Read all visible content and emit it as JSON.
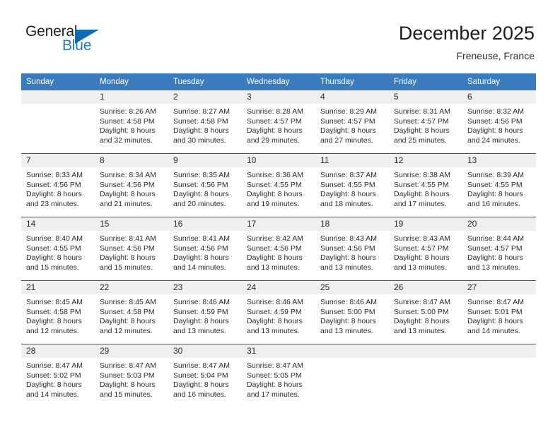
{
  "logo": {
    "word_top": "General",
    "word_bottom": "Blue",
    "triangle_color": "#0f6cb4",
    "blue_text_color": "#1f7cc2"
  },
  "header": {
    "title": "December 2025",
    "subtitle": "Freneuse, France"
  },
  "theme": {
    "header_row_bg": "#3a7cbe",
    "daynum_band_bg": "#efefef",
    "grid_line": "#1d5fa0"
  },
  "weekday_headers": [
    "Sunday",
    "Monday",
    "Tuesday",
    "Wednesday",
    "Thursday",
    "Friday",
    "Saturday"
  ],
  "labels": {
    "sunrise_prefix": "Sunrise:",
    "sunset_prefix": "Sunset:",
    "daylight_prefix": "Daylight:"
  },
  "weeks": [
    [
      {
        "day": "",
        "sunrise": "",
        "sunset": "",
        "daylight_1": "",
        "daylight_2": ""
      },
      {
        "day": "1",
        "sunrise": "Sunrise: 8:26 AM",
        "sunset": "Sunset: 4:58 PM",
        "daylight_1": "Daylight: 8 hours",
        "daylight_2": "and 32 minutes."
      },
      {
        "day": "2",
        "sunrise": "Sunrise: 8:27 AM",
        "sunset": "Sunset: 4:58 PM",
        "daylight_1": "Daylight: 8 hours",
        "daylight_2": "and 30 minutes."
      },
      {
        "day": "3",
        "sunrise": "Sunrise: 8:28 AM",
        "sunset": "Sunset: 4:57 PM",
        "daylight_1": "Daylight: 8 hours",
        "daylight_2": "and 29 minutes."
      },
      {
        "day": "4",
        "sunrise": "Sunrise: 8:29 AM",
        "sunset": "Sunset: 4:57 PM",
        "daylight_1": "Daylight: 8 hours",
        "daylight_2": "and 27 minutes."
      },
      {
        "day": "5",
        "sunrise": "Sunrise: 8:31 AM",
        "sunset": "Sunset: 4:57 PM",
        "daylight_1": "Daylight: 8 hours",
        "daylight_2": "and 25 minutes."
      },
      {
        "day": "6",
        "sunrise": "Sunrise: 8:32 AM",
        "sunset": "Sunset: 4:56 PM",
        "daylight_1": "Daylight: 8 hours",
        "daylight_2": "and 24 minutes."
      }
    ],
    [
      {
        "day": "7",
        "sunrise": "Sunrise: 8:33 AM",
        "sunset": "Sunset: 4:56 PM",
        "daylight_1": "Daylight: 8 hours",
        "daylight_2": "and 23 minutes."
      },
      {
        "day": "8",
        "sunrise": "Sunrise: 8:34 AM",
        "sunset": "Sunset: 4:56 PM",
        "daylight_1": "Daylight: 8 hours",
        "daylight_2": "and 21 minutes."
      },
      {
        "day": "9",
        "sunrise": "Sunrise: 8:35 AM",
        "sunset": "Sunset: 4:56 PM",
        "daylight_1": "Daylight: 8 hours",
        "daylight_2": "and 20 minutes."
      },
      {
        "day": "10",
        "sunrise": "Sunrise: 8:36 AM",
        "sunset": "Sunset: 4:55 PM",
        "daylight_1": "Daylight: 8 hours",
        "daylight_2": "and 19 minutes."
      },
      {
        "day": "11",
        "sunrise": "Sunrise: 8:37 AM",
        "sunset": "Sunset: 4:55 PM",
        "daylight_1": "Daylight: 8 hours",
        "daylight_2": "and 18 minutes."
      },
      {
        "day": "12",
        "sunrise": "Sunrise: 8:38 AM",
        "sunset": "Sunset: 4:55 PM",
        "daylight_1": "Daylight: 8 hours",
        "daylight_2": "and 17 minutes."
      },
      {
        "day": "13",
        "sunrise": "Sunrise: 8:39 AM",
        "sunset": "Sunset: 4:55 PM",
        "daylight_1": "Daylight: 8 hours",
        "daylight_2": "and 16 minutes."
      }
    ],
    [
      {
        "day": "14",
        "sunrise": "Sunrise: 8:40 AM",
        "sunset": "Sunset: 4:55 PM",
        "daylight_1": "Daylight: 8 hours",
        "daylight_2": "and 15 minutes."
      },
      {
        "day": "15",
        "sunrise": "Sunrise: 8:41 AM",
        "sunset": "Sunset: 4:56 PM",
        "daylight_1": "Daylight: 8 hours",
        "daylight_2": "and 15 minutes."
      },
      {
        "day": "16",
        "sunrise": "Sunrise: 8:41 AM",
        "sunset": "Sunset: 4:56 PM",
        "daylight_1": "Daylight: 8 hours",
        "daylight_2": "and 14 minutes."
      },
      {
        "day": "17",
        "sunrise": "Sunrise: 8:42 AM",
        "sunset": "Sunset: 4:56 PM",
        "daylight_1": "Daylight: 8 hours",
        "daylight_2": "and 13 minutes."
      },
      {
        "day": "18",
        "sunrise": "Sunrise: 8:43 AM",
        "sunset": "Sunset: 4:56 PM",
        "daylight_1": "Daylight: 8 hours",
        "daylight_2": "and 13 minutes."
      },
      {
        "day": "19",
        "sunrise": "Sunrise: 8:43 AM",
        "sunset": "Sunset: 4:57 PM",
        "daylight_1": "Daylight: 8 hours",
        "daylight_2": "and 13 minutes."
      },
      {
        "day": "20",
        "sunrise": "Sunrise: 8:44 AM",
        "sunset": "Sunset: 4:57 PM",
        "daylight_1": "Daylight: 8 hours",
        "daylight_2": "and 13 minutes."
      }
    ],
    [
      {
        "day": "21",
        "sunrise": "Sunrise: 8:45 AM",
        "sunset": "Sunset: 4:58 PM",
        "daylight_1": "Daylight: 8 hours",
        "daylight_2": "and 12 minutes."
      },
      {
        "day": "22",
        "sunrise": "Sunrise: 8:45 AM",
        "sunset": "Sunset: 4:58 PM",
        "daylight_1": "Daylight: 8 hours",
        "daylight_2": "and 12 minutes."
      },
      {
        "day": "23",
        "sunrise": "Sunrise: 8:46 AM",
        "sunset": "Sunset: 4:59 PM",
        "daylight_1": "Daylight: 8 hours",
        "daylight_2": "and 13 minutes."
      },
      {
        "day": "24",
        "sunrise": "Sunrise: 8:46 AM",
        "sunset": "Sunset: 4:59 PM",
        "daylight_1": "Daylight: 8 hours",
        "daylight_2": "and 13 minutes."
      },
      {
        "day": "25",
        "sunrise": "Sunrise: 8:46 AM",
        "sunset": "Sunset: 5:00 PM",
        "daylight_1": "Daylight: 8 hours",
        "daylight_2": "and 13 minutes."
      },
      {
        "day": "26",
        "sunrise": "Sunrise: 8:47 AM",
        "sunset": "Sunset: 5:00 PM",
        "daylight_1": "Daylight: 8 hours",
        "daylight_2": "and 13 minutes."
      },
      {
        "day": "27",
        "sunrise": "Sunrise: 8:47 AM",
        "sunset": "Sunset: 5:01 PM",
        "daylight_1": "Daylight: 8 hours",
        "daylight_2": "and 14 minutes."
      }
    ],
    [
      {
        "day": "28",
        "sunrise": "Sunrise: 8:47 AM",
        "sunset": "Sunset: 5:02 PM",
        "daylight_1": "Daylight: 8 hours",
        "daylight_2": "and 14 minutes."
      },
      {
        "day": "29",
        "sunrise": "Sunrise: 8:47 AM",
        "sunset": "Sunset: 5:03 PM",
        "daylight_1": "Daylight: 8 hours",
        "daylight_2": "and 15 minutes."
      },
      {
        "day": "30",
        "sunrise": "Sunrise: 8:47 AM",
        "sunset": "Sunset: 5:04 PM",
        "daylight_1": "Daylight: 8 hours",
        "daylight_2": "and 16 minutes."
      },
      {
        "day": "31",
        "sunrise": "Sunrise: 8:47 AM",
        "sunset": "Sunset: 5:05 PM",
        "daylight_1": "Daylight: 8 hours",
        "daylight_2": "and 17 minutes."
      },
      {
        "day": "",
        "sunrise": "",
        "sunset": "",
        "daylight_1": "",
        "daylight_2": ""
      },
      {
        "day": "",
        "sunrise": "",
        "sunset": "",
        "daylight_1": "",
        "daylight_2": ""
      },
      {
        "day": "",
        "sunrise": "",
        "sunset": "",
        "daylight_1": "",
        "daylight_2": ""
      }
    ]
  ]
}
